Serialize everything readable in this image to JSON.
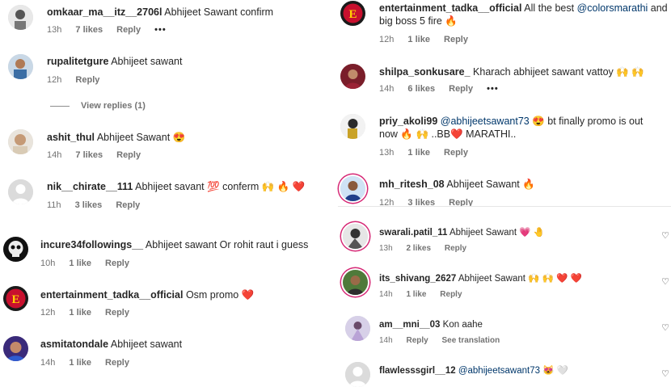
{
  "left_column": [
    {
      "username": "omkaar_ma__itz__2706l",
      "text": "Abhijeet Sawant confirm",
      "time": "13h",
      "likes": "7 likes",
      "reply": "Reply",
      "more": "•••"
    },
    {
      "username": "rupalitetgure",
      "text": "Abhijeet sawant",
      "time": "12h",
      "reply": "Reply",
      "view_replies": "View replies (1)"
    },
    {
      "username": "ashit_thul",
      "text": "Abhijeet Sawant 😍",
      "time": "14h",
      "likes": "7 likes",
      "reply": "Reply"
    },
    {
      "username": "nik__chirate__111",
      "text": "Abhijeet savant 💯 conferm 🙌 🔥 ❤️",
      "time": "11h",
      "likes": "3 likes",
      "reply": "Reply"
    },
    {
      "username": "incure34followings__",
      "text": "Abhijeet sawant Or rohit raut i guess",
      "time": "10h",
      "likes": "1 like",
      "reply": "Reply"
    },
    {
      "username": "entertainment_tadka__official",
      "text": "Osm promo ❤️",
      "time": "12h",
      "likes": "1 like",
      "reply": "Reply"
    },
    {
      "username": "asmitatondale",
      "text": "Abhijeet sawant",
      "time": "14h",
      "likes": "1 like",
      "reply": "Reply"
    }
  ],
  "right_column": [
    {
      "username": "entertainment_tadka__official",
      "text_pre": "All the best ",
      "mention": "@colorsmarathi",
      "text_post": " and big boss 5 fire 🔥",
      "time": "12h",
      "likes": "1 like",
      "reply": "Reply"
    },
    {
      "username": "shilpa_sonkusare_",
      "text": "Kharach abhijeet sawant vattoy 🙌 🙌",
      "time": "14h",
      "likes": "6 likes",
      "reply": "Reply",
      "more": "•••"
    },
    {
      "username": "priy_akoli99",
      "mention": "@abhijeetsawant73",
      "text_post": " 😍 bt finally promo is out now 🔥 🙌 ..BB❤️ MARATHI..",
      "time": "13h",
      "likes": "1 like",
      "reply": "Reply"
    },
    {
      "username": "mh_ritesh_08",
      "text": "Abhijeet Sawant 🔥",
      "time": "12h",
      "likes": "3 likes",
      "reply": "Reply"
    },
    {
      "username": "swarali.patil_11",
      "text": "Abhijeet Sawant 💗 🤚",
      "time": "13h",
      "likes": "2 likes",
      "reply": "Reply"
    },
    {
      "username": "its_shivang_2627",
      "text": "Abhijeet Sawant 🙌 🙌 ❤️ ❤️",
      "time": "14h",
      "likes": "1 like",
      "reply": "Reply"
    },
    {
      "username": "am__mni__03",
      "text": "Kon aahe",
      "time": "14h",
      "reply": "Reply",
      "translation": "See translation"
    },
    {
      "username": "flawlesssgirl__12",
      "mention": "@abhijeetsawant73",
      "text_post": " 😻 🤍",
      "time": "",
      "reply": ""
    }
  ],
  "icons": {
    "like": "heart-outline-icon"
  },
  "colors": {
    "accent_ring": "#d62976",
    "mention": "#00376b",
    "meta": "#737373"
  }
}
